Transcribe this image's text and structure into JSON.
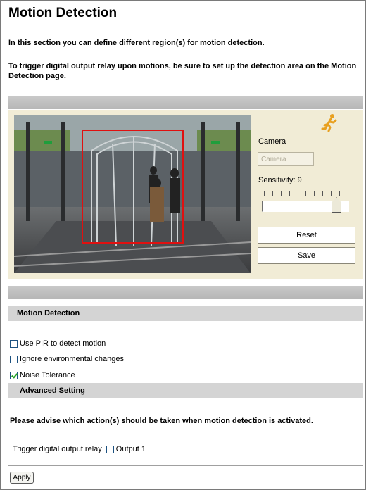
{
  "page": {
    "title": "Motion Detection",
    "intro_line1": "In this section you can define different region(s) for motion detection.",
    "intro_line2": "To trigger digital output relay upon motions, be sure to set up the detection area on the Motion Detection page."
  },
  "panel": {
    "motion_icon": "running-man-icon",
    "camera_label": "Camera",
    "camera_value": "Camera",
    "sensitivity_label": "Sensitivity: 9",
    "sensitivity": {
      "value": 9,
      "min": 0,
      "max": 10
    },
    "reset_label": "Reset",
    "save_label": "Save"
  },
  "motion_section": {
    "heading": "Motion Detection",
    "options": [
      {
        "label": "Use PIR to detect motion",
        "checked": false
      },
      {
        "label": "Ignore environmental changes",
        "checked": false
      },
      {
        "label": "Noise Tolerance",
        "checked": true
      }
    ]
  },
  "advanced": {
    "heading": "Advanced Setting",
    "advise": "Please advise which action(s) should be taken when motion detection is activated.",
    "trigger_label": "Trigger digital output relay",
    "output_label": "Output 1",
    "output_checked": false
  },
  "footer": {
    "apply_label": "Apply"
  },
  "colors": {
    "panel_bg": "#f1ecd6",
    "region_border": "#e01010",
    "section_bg": "#d4d4d4"
  }
}
